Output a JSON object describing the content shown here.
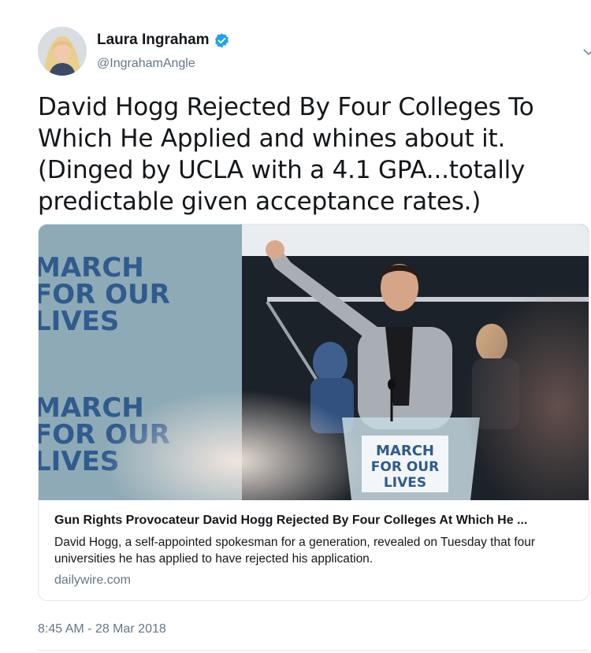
{
  "author": {
    "display_name": "Laura Ingraham",
    "handle": "@IngrahamAngle",
    "verified": true
  },
  "tweet": {
    "text": "David Hogg Rejected By Four Colleges To Which He Applied and whines about it. (Dinged by UCLA with a 4.1 GPA...totally predictable given acceptance rates.)",
    "timestamp": "8:45 AM - 28 Mar 2018"
  },
  "card": {
    "image": {
      "sign_text_lines": [
        "MARCH",
        "FOR OUR",
        "LIVES"
      ]
    },
    "title": "Gun Rights Provocateur David Hogg Rejected By Four Colleges At Which He ...",
    "description": "David Hogg, a self-appointed spokesman for a generation, revealed on Tuesday that four universities he has applied to have rejected his application.",
    "domain": "dailywire.com"
  },
  "colors": {
    "verified": "#1da1f2",
    "secondary_text": "#657786",
    "primary_text": "#14171a",
    "border": "#e1e8ed"
  },
  "icons": {
    "verified": "verified-badge-icon",
    "caret": "chevron-down-icon"
  }
}
